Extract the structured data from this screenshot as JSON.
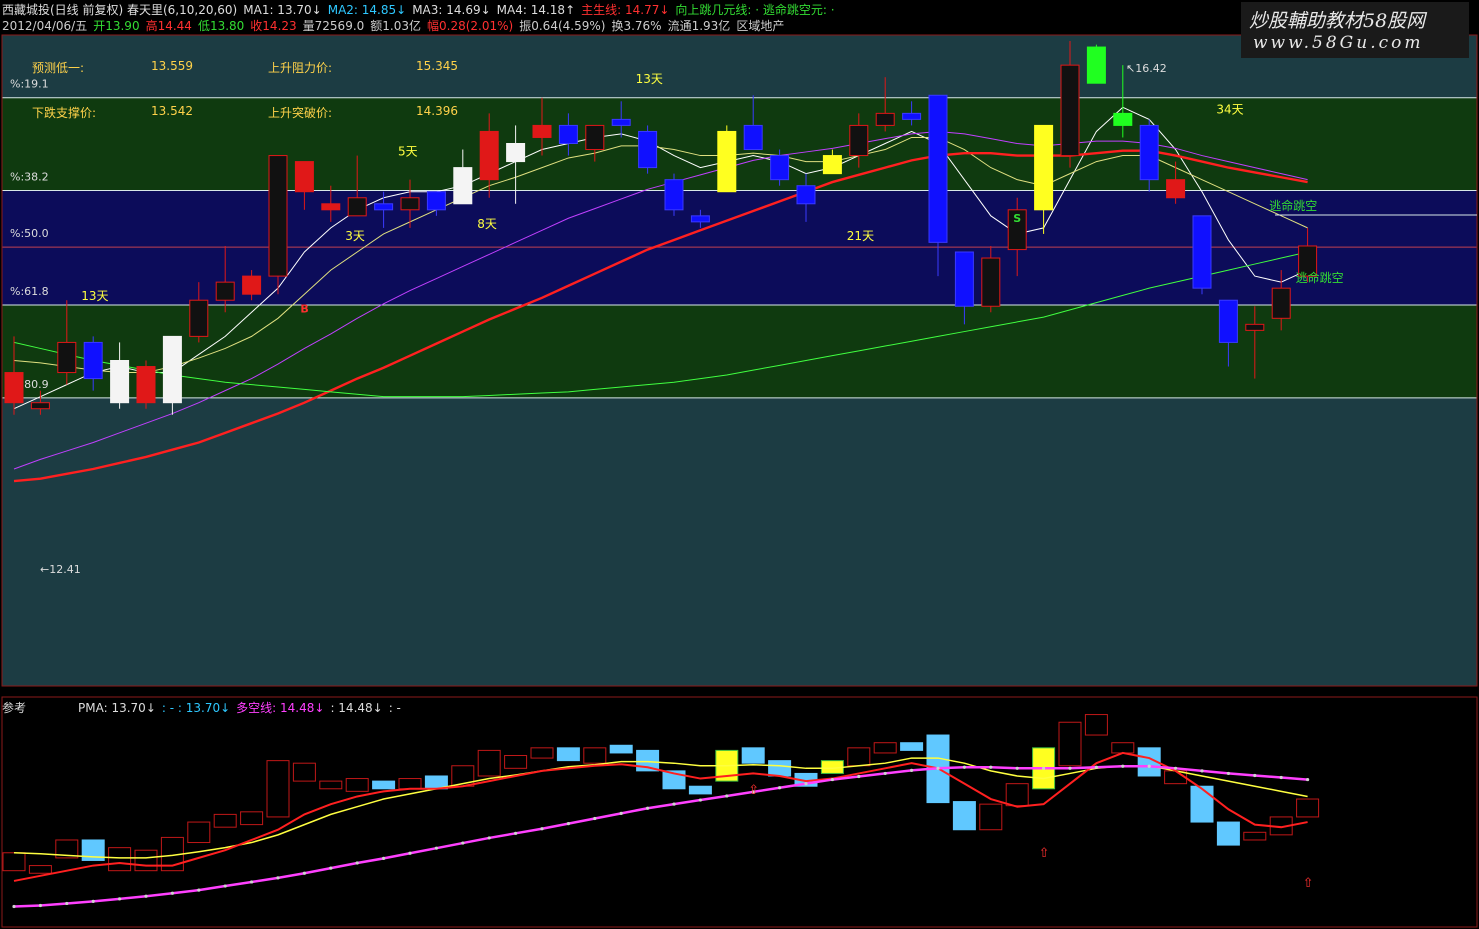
{
  "header": {
    "row1": [
      {
        "t": "西藏城投(日线 前复权) 春天里(6,10,20,60)",
        "c": "#ddd"
      },
      {
        "t": "MA1: 13.70↓",
        "c": "#ddd"
      },
      {
        "t": "MA2: 14.85↓",
        "c": "#2ec8ff"
      },
      {
        "t": "MA3: 14.69↓",
        "c": "#ddd"
      },
      {
        "t": "MA4: 14.18↑",
        "c": "#ddd"
      },
      {
        "t": "主生线: 14.77↓",
        "c": "#ff3030"
      },
      {
        "t": "向上跳几元线: · 逃命跳空元: ·",
        "c": "#33dd33"
      }
    ],
    "row2": [
      {
        "t": "2012/04/06/五",
        "c": "#ccc"
      },
      {
        "t": "开13.90",
        "c": "#33dd33"
      },
      {
        "t": "高14.44",
        "c": "#ff3030"
      },
      {
        "t": "低13.80",
        "c": "#33dd33"
      },
      {
        "t": "收14.23",
        "c": "#ff3030"
      },
      {
        "t": "量72569.0",
        "c": "#ccc"
      },
      {
        "t": "额1.03亿",
        "c": "#ccc"
      },
      {
        "t": "幅0.28(2.01%)",
        "c": "#ff3030"
      },
      {
        "t": "振0.64(4.59%)",
        "c": "#ccc"
      },
      {
        "t": "换3.76%",
        "c": "#ccc"
      },
      {
        "t": "流通1.93亿",
        "c": "#ccc"
      },
      {
        "t": "区域地产",
        "c": "#ccc"
      }
    ]
  },
  "watermark": {
    "line1": "炒股輔助教材58股网",
    "line2": "www.58Gu.com"
  },
  "info_panel": {
    "pred_low_label": "预测低一:",
    "pred_low_value": "13.559",
    "support_label": "下跌支撑价:",
    "support_value": "13.542",
    "resist_label": "上升阻力价:",
    "resist_value": "15.345",
    "break_label": "上升突破价:",
    "break_value": "14.396"
  },
  "fib_levels": [
    {
      "label": "%:19.1",
      "price": 17.08
    },
    {
      "label": "%:38.2",
      "price": 16.31
    },
    {
      "label": "%:50.0",
      "price": 15.84
    },
    {
      "label": "%:61.8",
      "price": 15.36
    },
    {
      "label": "%:80.9",
      "price": 14.59
    }
  ],
  "price_marks": {
    "high": "16.42",
    "low": "12.41"
  },
  "annotations": [
    {
      "t": "13天",
      "i": 3,
      "p": 15.4,
      "c": "#ffff40"
    },
    {
      "t": "5天",
      "i": 15,
      "p": 16.6,
      "c": "#ffff40"
    },
    {
      "t": "3天",
      "i": 13,
      "p": 15.9,
      "c": "#ffff40"
    },
    {
      "t": "8天",
      "i": 18,
      "p": 16.0,
      "c": "#ffff40"
    },
    {
      "t": "13天",
      "i": 24,
      "p": 17.2,
      "c": "#ffff40"
    },
    {
      "t": "21天",
      "i": 32,
      "p": 15.9,
      "c": "#ffff40"
    },
    {
      "t": "34天",
      "i": 46,
      "p": 16.95,
      "c": "#ffff40"
    },
    {
      "t": "逃命跳空",
      "i": 48,
      "p": 16.15,
      "c": "#33dd33"
    },
    {
      "t": "逃命跳空",
      "i": 49,
      "p": 15.55,
      "c": "#33dd33"
    }
  ],
  "signals": [
    {
      "t": "S",
      "i": 38,
      "p": 16.05,
      "c": "#33dd33"
    },
    {
      "t": "B",
      "i": 11,
      "p": 15.3,
      "c": "#ff3030"
    }
  ],
  "chart_data": {
    "type": "candlestick",
    "ylim": [
      12.2,
      16.6
    ],
    "candles": [
      {
        "o": 14.55,
        "c": 14.8,
        "h": 15.1,
        "l": 14.45,
        "k": "red"
      },
      {
        "o": 14.55,
        "c": 14.5,
        "h": 14.65,
        "l": 14.45,
        "k": "dark"
      },
      {
        "o": 14.8,
        "c": 15.05,
        "h": 15.4,
        "l": 14.7,
        "k": "dark"
      },
      {
        "o": 15.05,
        "c": 14.75,
        "h": 15.1,
        "l": 14.65,
        "k": "blue"
      },
      {
        "o": 14.55,
        "c": 14.9,
        "h": 15.05,
        "l": 14.5,
        "k": "white"
      },
      {
        "o": 14.85,
        "c": 14.55,
        "h": 14.9,
        "l": 14.5,
        "k": "red"
      },
      {
        "o": 14.55,
        "c": 15.1,
        "h": 15.1,
        "l": 14.45,
        "k": "white"
      },
      {
        "o": 15.1,
        "c": 15.4,
        "h": 15.55,
        "l": 15.05,
        "k": "dark"
      },
      {
        "o": 15.4,
        "c": 15.55,
        "h": 15.85,
        "l": 15.3,
        "k": "dark"
      },
      {
        "o": 15.45,
        "c": 15.6,
        "h": 15.65,
        "l": 15.4,
        "k": "red"
      },
      {
        "o": 15.6,
        "c": 16.6,
        "h": 16.6,
        "l": 15.45,
        "k": "dark"
      },
      {
        "o": 16.55,
        "c": 16.3,
        "h": 16.55,
        "l": 16.15,
        "k": "red"
      },
      {
        "o": 16.2,
        "c": 16.15,
        "h": 16.35,
        "l": 16.05,
        "k": "red"
      },
      {
        "o": 16.25,
        "c": 16.1,
        "h": 16.6,
        "l": 16.1,
        "k": "dark"
      },
      {
        "o": 16.2,
        "c": 16.15,
        "h": 16.3,
        "l": 16.0,
        "k": "blue"
      },
      {
        "o": 16.15,
        "c": 16.25,
        "h": 16.4,
        "l": 16.0,
        "k": "dark"
      },
      {
        "o": 16.3,
        "c": 16.15,
        "h": 16.3,
        "l": 16.1,
        "k": "blue"
      },
      {
        "o": 16.2,
        "c": 16.5,
        "h": 16.65,
        "l": 16.2,
        "k": "white"
      },
      {
        "o": 16.4,
        "c": 16.8,
        "h": 16.95,
        "l": 16.25,
        "k": "red"
      },
      {
        "o": 16.55,
        "c": 16.7,
        "h": 16.85,
        "l": 16.2,
        "k": "white"
      },
      {
        "o": 16.75,
        "c": 16.85,
        "h": 17.08,
        "l": 16.6,
        "k": "red"
      },
      {
        "o": 16.85,
        "c": 16.7,
        "h": 16.95,
        "l": 16.6,
        "k": "blue"
      },
      {
        "o": 16.65,
        "c": 16.85,
        "h": 16.85,
        "l": 16.55,
        "k": "dark"
      },
      {
        "o": 16.9,
        "c": 16.85,
        "h": 17.05,
        "l": 16.75,
        "k": "blue"
      },
      {
        "o": 16.8,
        "c": 16.5,
        "h": 16.85,
        "l": 16.45,
        "k": "blue"
      },
      {
        "o": 16.4,
        "c": 16.15,
        "h": 16.45,
        "l": 16.1,
        "k": "blue"
      },
      {
        "o": 16.1,
        "c": 16.05,
        "h": 16.15,
        "l": 16.0,
        "k": "blue"
      },
      {
        "o": 16.3,
        "c": 16.8,
        "h": 16.85,
        "l": 16.3,
        "k": "yellow"
      },
      {
        "o": 16.85,
        "c": 16.65,
        "h": 17.1,
        "l": 16.65,
        "k": "blue"
      },
      {
        "o": 16.6,
        "c": 16.4,
        "h": 16.65,
        "l": 16.35,
        "k": "blue"
      },
      {
        "o": 16.35,
        "c": 16.2,
        "h": 16.45,
        "l": 16.05,
        "k": "blue"
      },
      {
        "o": 16.45,
        "c": 16.6,
        "h": 16.65,
        "l": 16.45,
        "k": "yellow"
      },
      {
        "o": 16.6,
        "c": 16.85,
        "h": 16.95,
        "l": 16.5,
        "k": "dark"
      },
      {
        "o": 16.85,
        "c": 16.95,
        "h": 17.25,
        "l": 16.8,
        "k": "dark"
      },
      {
        "o": 16.95,
        "c": 16.9,
        "h": 17.05,
        "l": 16.85,
        "k": "blue"
      },
      {
        "o": 17.1,
        "c": 15.88,
        "h": 17.1,
        "l": 15.6,
        "k": "blue"
      },
      {
        "o": 15.8,
        "c": 15.35,
        "h": 15.8,
        "l": 15.2,
        "k": "blue"
      },
      {
        "o": 15.35,
        "c": 15.75,
        "h": 15.85,
        "l": 15.3,
        "k": "dark"
      },
      {
        "o": 15.82,
        "c": 16.15,
        "h": 16.25,
        "l": 15.6,
        "k": "dark"
      },
      {
        "o": 16.15,
        "c": 16.85,
        "h": 16.85,
        "l": 15.95,
        "k": "yellow"
      },
      {
        "o": 16.6,
        "c": 17.35,
        "h": 17.55,
        "l": 16.5,
        "k": "dark"
      },
      {
        "o": 17.2,
        "c": 17.5,
        "h": 17.52,
        "l": 17.2,
        "k": "green"
      },
      {
        "o": 16.95,
        "c": 16.85,
        "h": 17.35,
        "l": 16.75,
        "k": "green"
      },
      {
        "o": 16.85,
        "c": 16.4,
        "h": 16.9,
        "l": 16.3,
        "k": "blue"
      },
      {
        "o": 16.4,
        "c": 16.25,
        "h": 16.55,
        "l": 16.2,
        "k": "red"
      },
      {
        "o": 16.1,
        "c": 15.5,
        "h": 16.1,
        "l": 15.45,
        "k": "blue"
      },
      {
        "o": 15.4,
        "c": 15.05,
        "h": 15.4,
        "l": 14.85,
        "k": "blue"
      },
      {
        "o": 15.2,
        "c": 15.15,
        "h": 15.35,
        "l": 14.75,
        "k": "dark"
      },
      {
        "o": 15.25,
        "c": 15.5,
        "h": 15.65,
        "l": 15.15,
        "k": "dark"
      },
      {
        "o": 15.6,
        "c": 15.85,
        "h": 16.0,
        "l": 15.55,
        "k": "dark"
      }
    ],
    "series": [
      {
        "name": "MA1",
        "color": "#ffffff",
        "values": [
          14.5,
          14.6,
          14.7,
          14.8,
          14.85,
          14.8,
          14.8,
          14.95,
          15.1,
          15.3,
          15.5,
          15.8,
          16.0,
          16.15,
          16.25,
          16.3,
          16.3,
          16.35,
          16.45,
          16.55,
          16.65,
          16.7,
          16.75,
          16.78,
          16.72,
          16.6,
          16.5,
          16.55,
          16.6,
          16.55,
          16.45,
          16.5,
          16.6,
          16.7,
          16.8,
          16.7,
          16.4,
          16.1,
          15.95,
          16.0,
          16.4,
          16.8,
          17.0,
          16.9,
          16.65,
          16.3,
          15.9,
          15.6,
          15.55,
          15.65
        ]
      },
      {
        "name": "MA2",
        "color": "#e0e080",
        "values": [
          14.9,
          14.88,
          14.85,
          14.82,
          14.8,
          14.8,
          14.85,
          14.92,
          15.0,
          15.1,
          15.25,
          15.45,
          15.65,
          15.8,
          15.95,
          16.05,
          16.15,
          16.25,
          16.35,
          16.42,
          16.5,
          16.58,
          16.62,
          16.68,
          16.68,
          16.65,
          16.6,
          16.6,
          16.62,
          16.6,
          16.55,
          16.55,
          16.6,
          16.65,
          16.75,
          16.75,
          16.65,
          16.5,
          16.4,
          16.35,
          16.45,
          16.55,
          16.6,
          16.6,
          16.5,
          16.4,
          16.3,
          16.2,
          16.1,
          16.0
        ]
      },
      {
        "name": "MA3",
        "color": "#c040ff",
        "values": [
          14.0,
          14.08,
          14.15,
          14.22,
          14.3,
          14.38,
          14.46,
          14.55,
          14.65,
          14.75,
          14.87,
          15.0,
          15.12,
          15.25,
          15.37,
          15.48,
          15.58,
          15.68,
          15.78,
          15.88,
          15.98,
          16.08,
          16.16,
          16.24,
          16.32,
          16.38,
          16.44,
          16.5,
          16.56,
          16.6,
          16.63,
          16.66,
          16.7,
          16.74,
          16.78,
          16.8,
          16.78,
          16.74,
          16.7,
          16.68,
          16.7,
          16.72,
          16.72,
          16.7,
          16.66,
          16.6,
          16.55,
          16.5,
          16.45,
          16.4
        ]
      },
      {
        "name": "MA4",
        "color": "#ff2020",
        "values": [
          13.9,
          13.92,
          13.96,
          14.0,
          14.05,
          14.1,
          14.16,
          14.22,
          14.3,
          14.38,
          14.46,
          14.55,
          14.65,
          14.75,
          14.84,
          14.94,
          15.04,
          15.14,
          15.24,
          15.33,
          15.42,
          15.52,
          15.62,
          15.72,
          15.82,
          15.9,
          15.98,
          16.06,
          16.14,
          16.22,
          16.3,
          16.38,
          16.44,
          16.5,
          16.56,
          16.6,
          16.62,
          16.62,
          16.6,
          16.6,
          16.6,
          16.62,
          16.64,
          16.64,
          16.6,
          16.55,
          16.5,
          16.46,
          16.42,
          16.38
        ]
      },
      {
        "name": "MA5",
        "color": "#40ff40",
        "values": [
          15.05,
          15.0,
          14.95,
          14.9,
          14.86,
          14.82,
          14.78,
          14.75,
          14.72,
          14.7,
          14.68,
          14.66,
          14.64,
          14.62,
          14.6,
          14.6,
          14.6,
          14.6,
          14.61,
          14.62,
          14.63,
          14.64,
          14.66,
          14.68,
          14.7,
          14.72,
          14.75,
          14.78,
          14.82,
          14.86,
          14.9,
          14.94,
          14.98,
          15.02,
          15.06,
          15.1,
          15.14,
          15.18,
          15.22,
          15.26,
          15.32,
          15.38,
          15.44,
          15.5,
          15.55,
          15.6,
          15.65,
          15.7,
          15.75,
          15.8
        ]
      }
    ]
  },
  "sub_panel": {
    "title": "参考",
    "items": [
      {
        "t": "PMA: 13.70↓",
        "c": "#ddd"
      },
      {
        "t": ": - : 13.70↓",
        "c": "#2ec8ff"
      },
      {
        "t": "多空线: 14.48↓",
        "c": "#ff40ff"
      },
      {
        "t": ": 14.48↓",
        "c": "#ddd"
      },
      {
        "t": ": -",
        "c": "#ddd"
      }
    ]
  }
}
